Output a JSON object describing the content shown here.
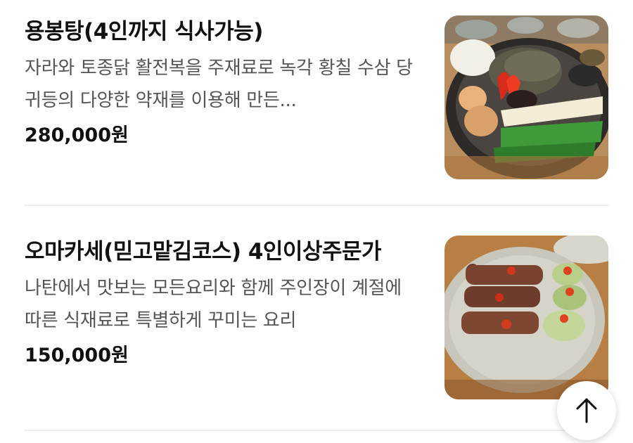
{
  "menu": [
    {
      "name": "용봉탕(4인까지 식사가능)",
      "description": "자라와 토종닭 활전복을 주재료로 녹각 황칠 수삼 당귀등의 다양한 약재를 이용해 만든...",
      "price": "280,000원",
      "image": "hot-pot-dish-photo"
    },
    {
      "name": "오마카세(믿고맡김코스) 4인이상주문가",
      "description": "나탄에서 맛보는 모든요리와 함께 주인장이 계절에 따른 식재료로 특별하게 꾸미는 요리",
      "price": "150,000원",
      "image": "beef-roll-platter-photo"
    }
  ],
  "scroll_top_icon": "arrow-up-icon"
}
